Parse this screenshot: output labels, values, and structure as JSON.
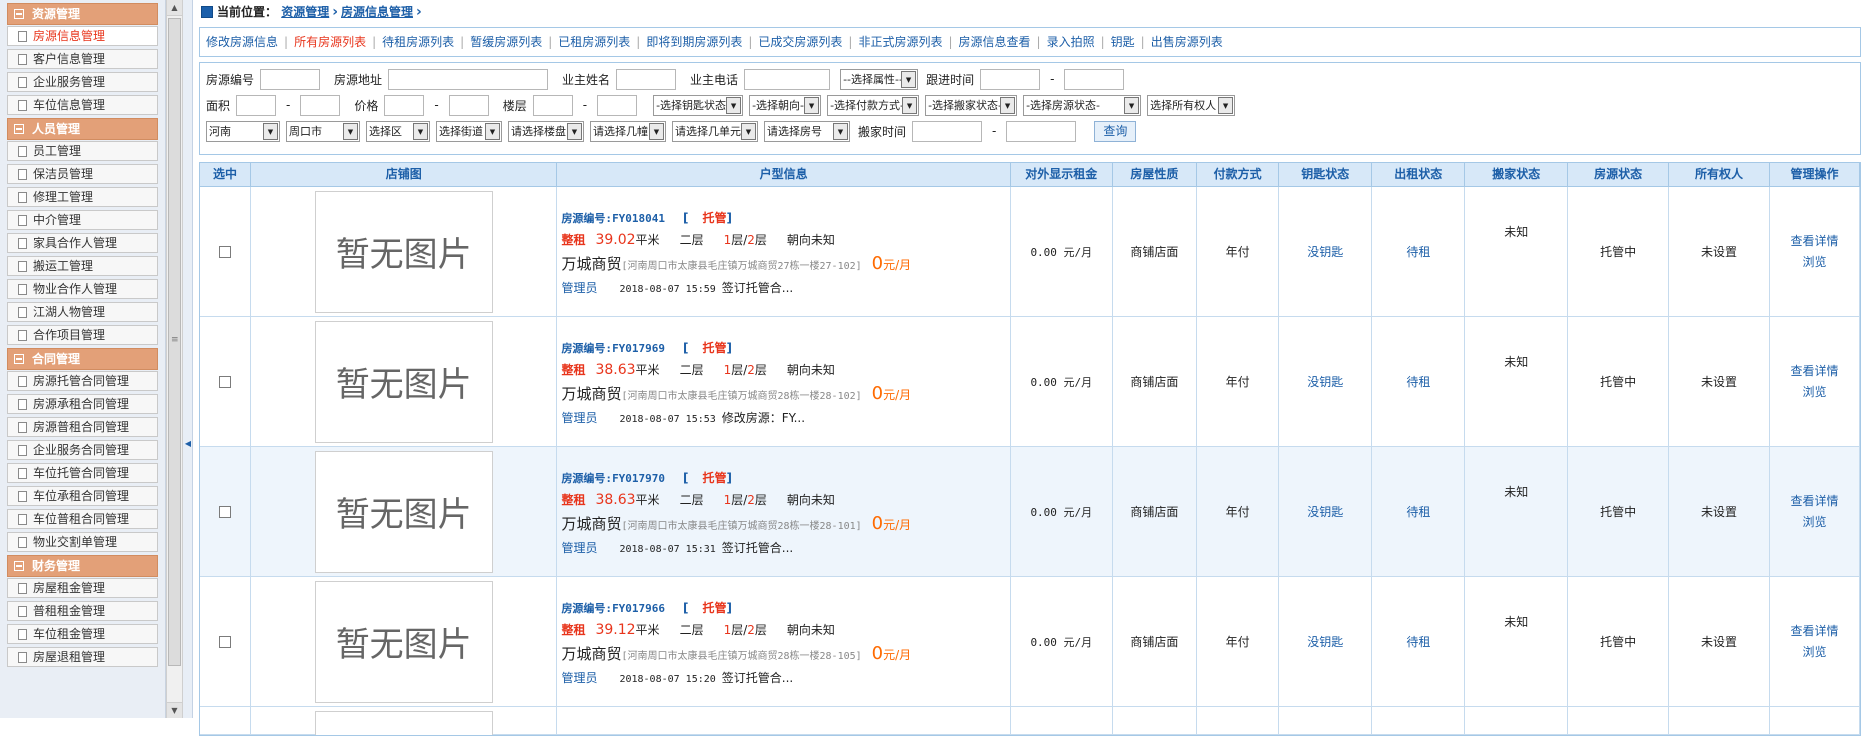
{
  "sidebar": {
    "groups": [
      {
        "title": "资源管理",
        "items": [
          "房源信息管理",
          "客户信息管理",
          "企业服务管理",
          "车位信息管理"
        ]
      },
      {
        "title": "人员管理",
        "items": [
          "员工管理",
          "保洁员管理",
          "修理工管理",
          "中介管理",
          "家具合作人管理",
          "搬运工管理",
          "物业合作人管理",
          "江湖人物管理",
          "合作项目管理"
        ]
      },
      {
        "title": "合同管理",
        "items": [
          "房源托管合同管理",
          "房源承租合同管理",
          "房源普租合同管理",
          "企业服务合同管理",
          "车位托管合同管理",
          "车位承租合同管理",
          "车位普租合同管理",
          "物业交割单管理"
        ]
      },
      {
        "title": "财务管理",
        "items": [
          "房屋租金管理",
          "普租租金管理",
          "车位租金管理",
          "房屋退租管理"
        ]
      }
    ],
    "active_item": "房源信息管理"
  },
  "breadcrumb": {
    "label": "当前位置：",
    "links": [
      "资源管理",
      "房源信息管理"
    ]
  },
  "tabs": [
    "修改房源信息",
    "所有房源列表",
    "待租房源列表",
    "暂缓房源列表",
    "已租房源列表",
    "即将到期房源列表",
    "已成交房源列表",
    "非正式房源列表",
    "房源信息查看",
    "录入拍照",
    "钥匙",
    "出售房源列表"
  ],
  "active_tab": "所有房源列表",
  "filters": {
    "row1": {
      "code": "房源编号",
      "address": "房源地址",
      "owner_name": "业主姓名",
      "owner_phone": "业主电话",
      "property_select": "--选择属性--",
      "followup": "跟进时间",
      "dash": "-"
    },
    "row2": {
      "area": "面积",
      "price": "价格",
      "floor": "楼层",
      "dash": "-",
      "key_select": "-选择钥匙状态-",
      "orientation_select": "-选择朝向-",
      "payment_select": "-选择付款方式-",
      "moving_select": "-选择搬家状态-",
      "status_select": "-选择房源状态-",
      "owner_select": "选择所有权人"
    },
    "row3": {
      "province": "河南",
      "city": "周口市",
      "district": "选择区",
      "street": "选择街道",
      "building": "请选择楼盘",
      "block": "请选择几幢",
      "unit": "请选择几单元",
      "room": "请选择房号",
      "move_time": "搬家时间",
      "dash": "-",
      "search_btn": "查询"
    }
  },
  "table": {
    "headers": [
      "选中",
      "店铺图",
      "户型信息",
      "对外显示租金",
      "房屋性质",
      "付款方式",
      "钥匙状态",
      "出租状态",
      "搬家状态",
      "房源状态",
      "所有权人",
      "管理操作"
    ],
    "no_image": "暂无图片",
    "rows": [
      {
        "code_label": "房源编号:",
        "code": "FY018041",
        "tag_l": "[",
        "tag": "托管",
        "tag_r": "]",
        "type": "整租",
        "area": "39.02",
        "area_unit": "平米",
        "level": "二层",
        "floor_cur": "1",
        "floor_sep": "层/",
        "floor_total": "2",
        "floor_end": "层",
        "orientation": "朝向未知",
        "name": "万城商贸",
        "address": "[河南周口市太康县毛庄镇万城商贸27栋一楼27-102]",
        "rent": "0",
        "rent_unit": "元/月",
        "manager": "管理员",
        "datetime": "2018-08-07 15:59",
        "note": "签订托管合...",
        "display_rent": "0.00 元/月",
        "nature": "商铺店面",
        "payment": "年付",
        "key": "没钥匙",
        "rent_status": "待租",
        "moving": "未知",
        "house_status": "托管中",
        "owner": "未设置",
        "op1": "查看详情",
        "op2": "浏览"
      },
      {
        "code_label": "房源编号:",
        "code": "FY017969",
        "tag_l": "[",
        "tag": "托管",
        "tag_r": "]",
        "type": "整租",
        "area": "38.63",
        "area_unit": "平米",
        "level": "二层",
        "floor_cur": "1",
        "floor_sep": "层/",
        "floor_total": "2",
        "floor_end": "层",
        "orientation": "朝向未知",
        "name": "万城商贸",
        "address": "[河南周口市太康县毛庄镇万城商贸28栋一楼28-102]",
        "rent": "0",
        "rent_unit": "元/月",
        "manager": "管理员",
        "datetime": "2018-08-07 15:53",
        "note": "修改房源：FY...",
        "display_rent": "0.00 元/月",
        "nature": "商铺店面",
        "payment": "年付",
        "key": "没钥匙",
        "rent_status": "待租",
        "moving": "未知",
        "house_status": "托管中",
        "owner": "未设置",
        "op1": "查看详情",
        "op2": "浏览"
      },
      {
        "code_label": "房源编号:",
        "code": "FY017970",
        "tag_l": "[",
        "tag": "托管",
        "tag_r": "]",
        "type": "整租",
        "area": "38.63",
        "area_unit": "平米",
        "level": "二层",
        "floor_cur": "1",
        "floor_sep": "层/",
        "floor_total": "2",
        "floor_end": "层",
        "orientation": "朝向未知",
        "name": "万城商贸",
        "address": "[河南周口市太康县毛庄镇万城商贸28栋一楼28-101]",
        "rent": "0",
        "rent_unit": "元/月",
        "manager": "管理员",
        "datetime": "2018-08-07 15:31",
        "note": "签订托管合...",
        "display_rent": "0.00 元/月",
        "nature": "商铺店面",
        "payment": "年付",
        "key": "没钥匙",
        "rent_status": "待租",
        "moving": "未知",
        "house_status": "托管中",
        "owner": "未设置",
        "op1": "查看详情",
        "op2": "浏览"
      },
      {
        "code_label": "房源编号:",
        "code": "FY017966",
        "tag_l": "[",
        "tag": "托管",
        "tag_r": "]",
        "type": "整租",
        "area": "39.12",
        "area_unit": "平米",
        "level": "二层",
        "floor_cur": "1",
        "floor_sep": "层/",
        "floor_total": "2",
        "floor_end": "层",
        "orientation": "朝向未知",
        "name": "万城商贸",
        "address": "[河南周口市太康县毛庄镇万城商贸28栋一楼28-105]",
        "rent": "0",
        "rent_unit": "元/月",
        "manager": "管理员",
        "datetime": "2018-08-07 15:20",
        "note": "签订托管合...",
        "display_rent": "0.00 元/月",
        "nature": "商铺店面",
        "payment": "年付",
        "key": "没钥匙",
        "rent_status": "待租",
        "moving": "未知",
        "house_status": "托管中",
        "owner": "未设置",
        "op1": "查看详情",
        "op2": "浏览"
      }
    ]
  },
  "colors": {
    "accent": "#1d5fa8",
    "highlight": "#e8351c",
    "rent": "#ff6a00",
    "sidebar_head": "#e3a078",
    "table_head": "#d7e8f8"
  }
}
